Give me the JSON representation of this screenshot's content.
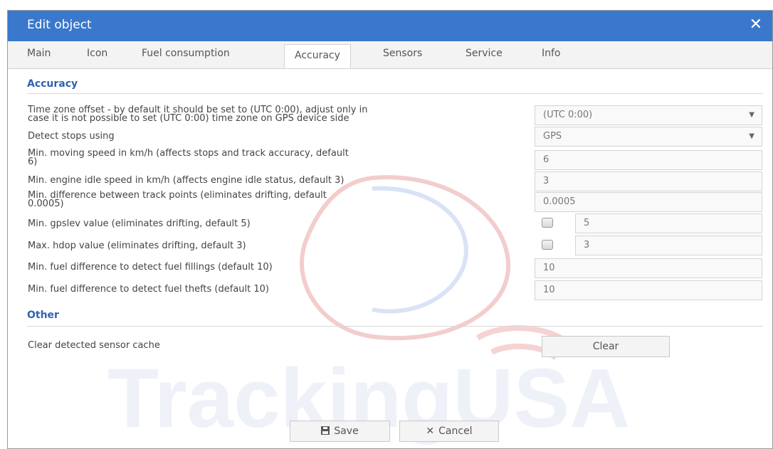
{
  "dialog": {
    "title": "Edit object",
    "close_icon": "close-icon"
  },
  "tabs": [
    {
      "label": "Main"
    },
    {
      "label": "Icon"
    },
    {
      "label": "Fuel consumption"
    },
    {
      "label": "Accuracy",
      "active": true
    },
    {
      "label": "Sensors"
    },
    {
      "label": "Service"
    },
    {
      "label": "Info"
    }
  ],
  "accuracy": {
    "heading": "Accuracy",
    "timezone": {
      "label_line1": "Time zone offset - by default it should be set to (UTC 0:00), adjust only in",
      "label_line2": "case it is not possible to set (UTC 0:00) time zone on GPS device side",
      "value": "(UTC 0:00)"
    },
    "detect_stops": {
      "label": "Detect stops using",
      "value": "GPS"
    },
    "min_moving_speed": {
      "label_line1": "Min. moving speed in km/h (affects stops and track accuracy, default",
      "label_line2": "6)",
      "value": "6"
    },
    "min_engine_idle_speed": {
      "label": "Min. engine idle speed in km/h (affects engine idle status, default 3)",
      "value": "3"
    },
    "min_track_point_diff": {
      "label_line1": "Min. difference between track points (eliminates drifting, default",
      "label_line2": "0.0005)",
      "value": "0.0005"
    },
    "min_gpslev": {
      "label": "Min. gpslev value (eliminates drifting, default 5)",
      "value": "5",
      "checked": false
    },
    "max_hdop": {
      "label": "Max. hdop value (eliminates drifting, default 3)",
      "value": "3",
      "checked": false
    },
    "fuel_fillings": {
      "label": "Min. fuel difference to detect fuel fillings (default 10)",
      "value": "10"
    },
    "fuel_thefts": {
      "label": "Min. fuel difference to detect fuel thefts (default 10)",
      "value": "10"
    }
  },
  "other": {
    "heading": "Other",
    "clear_cache_label": "Clear detected sensor cache",
    "clear_button": "Clear"
  },
  "footer": {
    "save_label": "Save",
    "cancel_label": "Cancel",
    "save_icon": "floppy-icon",
    "cancel_icon": "x-icon"
  },
  "watermark": {
    "text": "TrackingUSA"
  },
  "colors": {
    "titlebar": "#3a78cc",
    "section_heading": "#2f63b0"
  }
}
